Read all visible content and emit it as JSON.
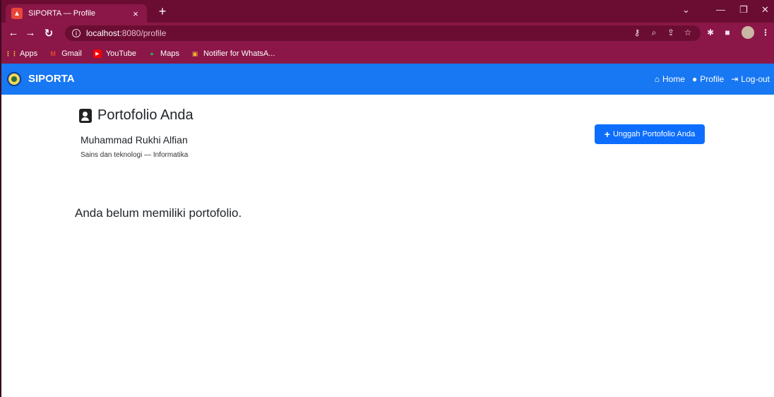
{
  "browser": {
    "tab_title": "SIPORTA — Profile",
    "tab_close": "×",
    "new_tab": "+",
    "url_host": "localhost",
    "url_path": ":8080/profile",
    "bookmarks": [
      {
        "label": "Apps",
        "icon": "apps-grid-icon"
      },
      {
        "label": "Gmail",
        "icon": "gmail-icon"
      },
      {
        "label": "YouTube",
        "icon": "youtube-icon"
      },
      {
        "label": "Maps",
        "icon": "maps-icon"
      },
      {
        "label": "Notifier for WhatsA...",
        "icon": "notifier-icon"
      }
    ]
  },
  "app": {
    "brand": "SIPORTA",
    "nav": {
      "home": "Home",
      "profile": "Profile",
      "logout": "Log-out"
    }
  },
  "main": {
    "title": "Portofolio Anda",
    "user_name": "Muhammad Rukhi Alfian",
    "user_meta": "Sains dan teknologi — Informatika",
    "upload_button": "Unggah Portofolio Anda",
    "empty_message": "Anda belum memiliki portofolio."
  },
  "colors": {
    "browser_frame": "#8a1747",
    "navbar": "#1877f2",
    "primary_button": "#0d6efd"
  }
}
